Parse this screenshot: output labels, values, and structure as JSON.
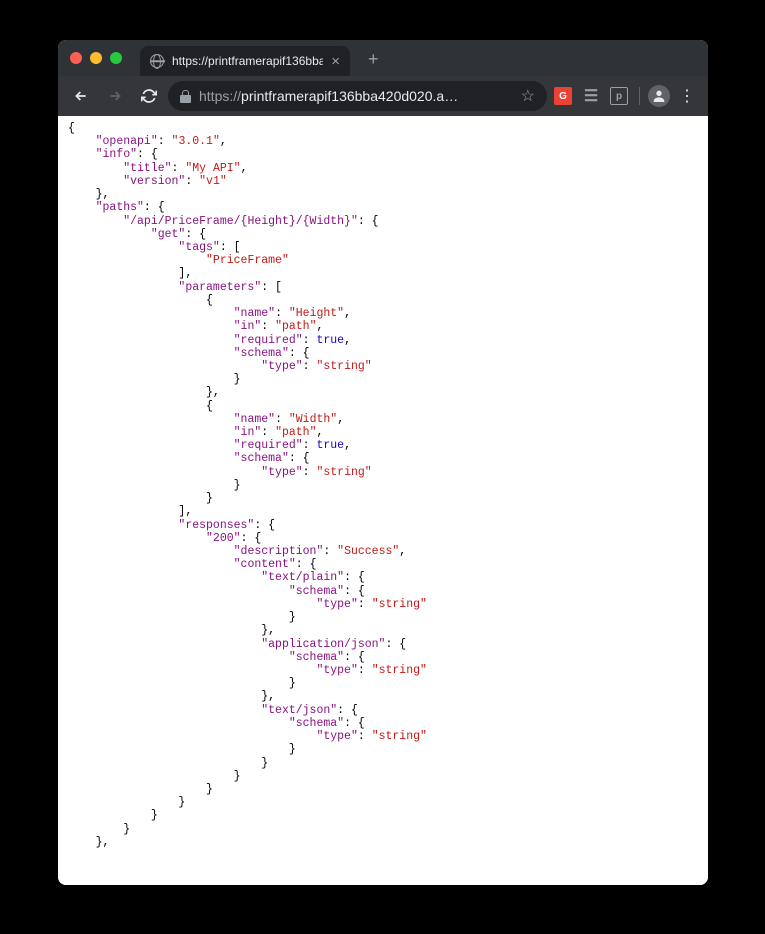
{
  "tab": {
    "title": "https://printframerapif136bba4"
  },
  "url": {
    "scheme": "https://",
    "host": "printframerapif136bba420d020.a",
    "ellipsis": "…"
  },
  "json": {
    "k_openapi": "\"openapi\"",
    "v_openapi": "\"3.0.1\"",
    "k_info": "\"info\"",
    "k_title": "\"title\"",
    "v_title": "\"My API\"",
    "k_version": "\"version\"",
    "v_version": "\"v1\"",
    "k_paths": "\"paths\"",
    "k_path1": "\"/api/PriceFrame/{Height}/{Width}\"",
    "k_get": "\"get\"",
    "k_tags": "\"tags\"",
    "v_tag1": "\"PriceFrame\"",
    "k_parameters": "\"parameters\"",
    "k_name": "\"name\"",
    "v_height": "\"Height\"",
    "v_width": "\"Width\"",
    "k_in": "\"in\"",
    "v_path": "\"path\"",
    "k_required": "\"required\"",
    "v_true": "true",
    "k_schema": "\"schema\"",
    "k_type": "\"type\"",
    "v_string": "\"string\"",
    "k_responses": "\"responses\"",
    "k_200": "\"200\"",
    "k_description": "\"description\"",
    "v_success": "\"Success\"",
    "k_content": "\"content\"",
    "k_textplain": "\"text/plain\"",
    "k_appjson": "\"application/json\"",
    "k_textjson": "\"text/json\""
  }
}
